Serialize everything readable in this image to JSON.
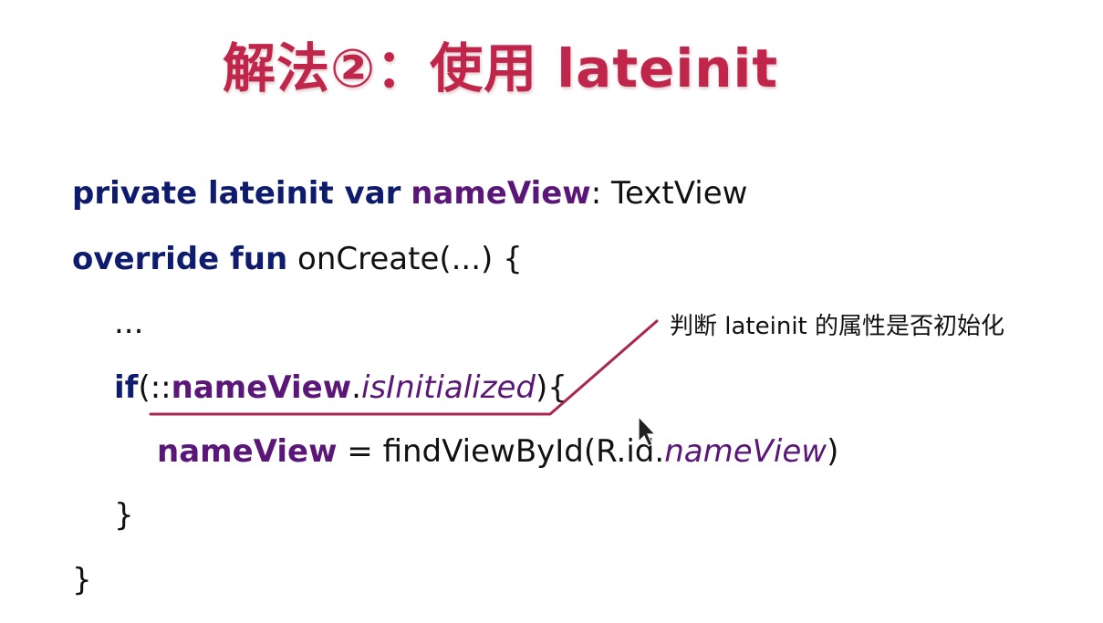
{
  "slide": {
    "title": "解法②：使用 lateinit",
    "annotation": "判断 lateinit 的属性是否初始化",
    "colors": {
      "title": "#c0254a",
      "keyword": "#0f1c6e",
      "identifier": "#5a1778",
      "annotation_line": "#a8274e"
    }
  },
  "code": {
    "line1": {
      "kw": "private lateinit var",
      "ident": "nameView",
      "rest": ": TextView"
    },
    "line2": {
      "kw": "override fun",
      "rest": "onCreate(...) {"
    },
    "line3": {
      "text": "..."
    },
    "line4": {
      "kw": "if",
      "open": "(::",
      "ident": "nameView",
      "dot": ".",
      "ital": "isInitialized",
      "close": "){"
    },
    "line5": {
      "ident": "nameView",
      "mid": " = findViewById(R.id.",
      "ital": "nameView",
      "close": ")"
    },
    "line6": {
      "text": "}"
    },
    "line7": {
      "text": "}"
    }
  }
}
